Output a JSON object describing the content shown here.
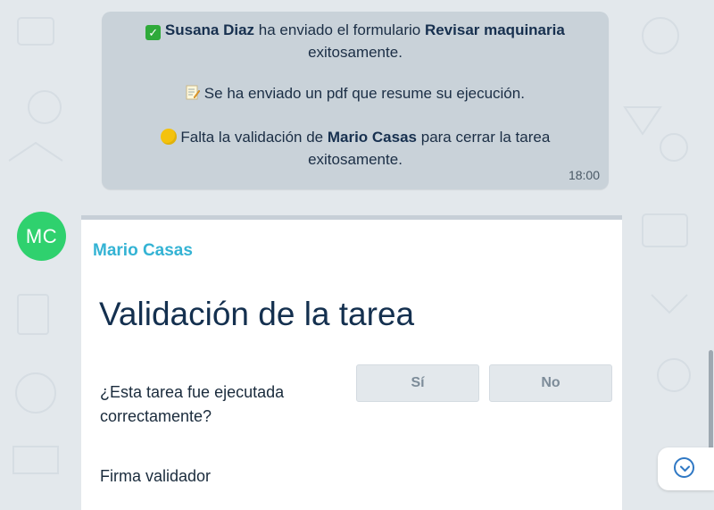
{
  "system_message": {
    "line1_user": "Susana Diaz",
    "line1_text": " ha enviado el formulario ",
    "line1_form": "Revisar maquinaria",
    "line1_end": "exitosamente.",
    "line2_text": "Se ha enviado un pdf que resume su ejecución.",
    "line3_prefix": "Falta la validación de ",
    "line3_user": "Mario Casas",
    "line3_suffix": " para cerrar la tarea",
    "line3_end": "exitosamente.",
    "time": "18:00",
    "icons": [
      "check-mark-icon",
      "memo-icon",
      "yellow-circle-icon"
    ]
  },
  "message": {
    "avatar_initials": "MC",
    "sender": "Mario Casas",
    "form_title": "Validación de la tarea",
    "question": "¿Esta tarea fue ejecutada correctamente?",
    "options": [
      "Sí",
      "No"
    ],
    "signature_label": "Firma validador"
  },
  "colors": {
    "background": "#e3e8ec",
    "system_bubble": "#c9d2d9",
    "avatar": "#2fd16e",
    "sender_name": "#34b3d4",
    "title": "#14304f",
    "scroll_icon": "#2f78c4"
  }
}
